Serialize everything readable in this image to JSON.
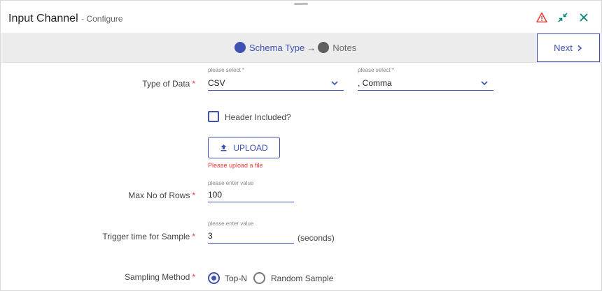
{
  "header": {
    "title": "Input Channel",
    "subtitle": "- Configure",
    "icons": [
      "warning-icon",
      "collapse-icon",
      "close-icon"
    ],
    "colors": {
      "warning": "#e53935",
      "accent": "#00897b"
    }
  },
  "steps": [
    {
      "label": "Schema Type",
      "state": "active"
    },
    {
      "label": "Notes",
      "state": "inactive"
    }
  ],
  "step_arrow": "→",
  "next_button": {
    "label": "Next"
  },
  "form": {
    "type_of_data": {
      "label": "Type of Data",
      "required": "*",
      "select1": {
        "hint": "please select *",
        "value": "CSV"
      },
      "select2": {
        "hint": "please select *",
        "value": ", Comma"
      }
    },
    "header_included": {
      "label": "Header Included?",
      "checked": false
    },
    "upload": {
      "label": "UPLOAD",
      "error": "Please upload a file"
    },
    "max_rows": {
      "label": "Max No of Rows",
      "required": "*",
      "hint": "please enter value",
      "value": "100"
    },
    "trigger_time": {
      "label": "Trigger time for Sample",
      "required": "*",
      "hint": "please enter value",
      "value": "3",
      "unit": "(seconds)"
    },
    "sampling_method": {
      "label": "Sampling Method",
      "required": "*",
      "options": [
        {
          "label": "Top-N",
          "checked": true
        },
        {
          "label": "Random Sample",
          "checked": false
        }
      ]
    }
  },
  "colors": {
    "primary": "#3f51b5",
    "error": "#e53935",
    "stepbar_bg": "#ececec"
  }
}
